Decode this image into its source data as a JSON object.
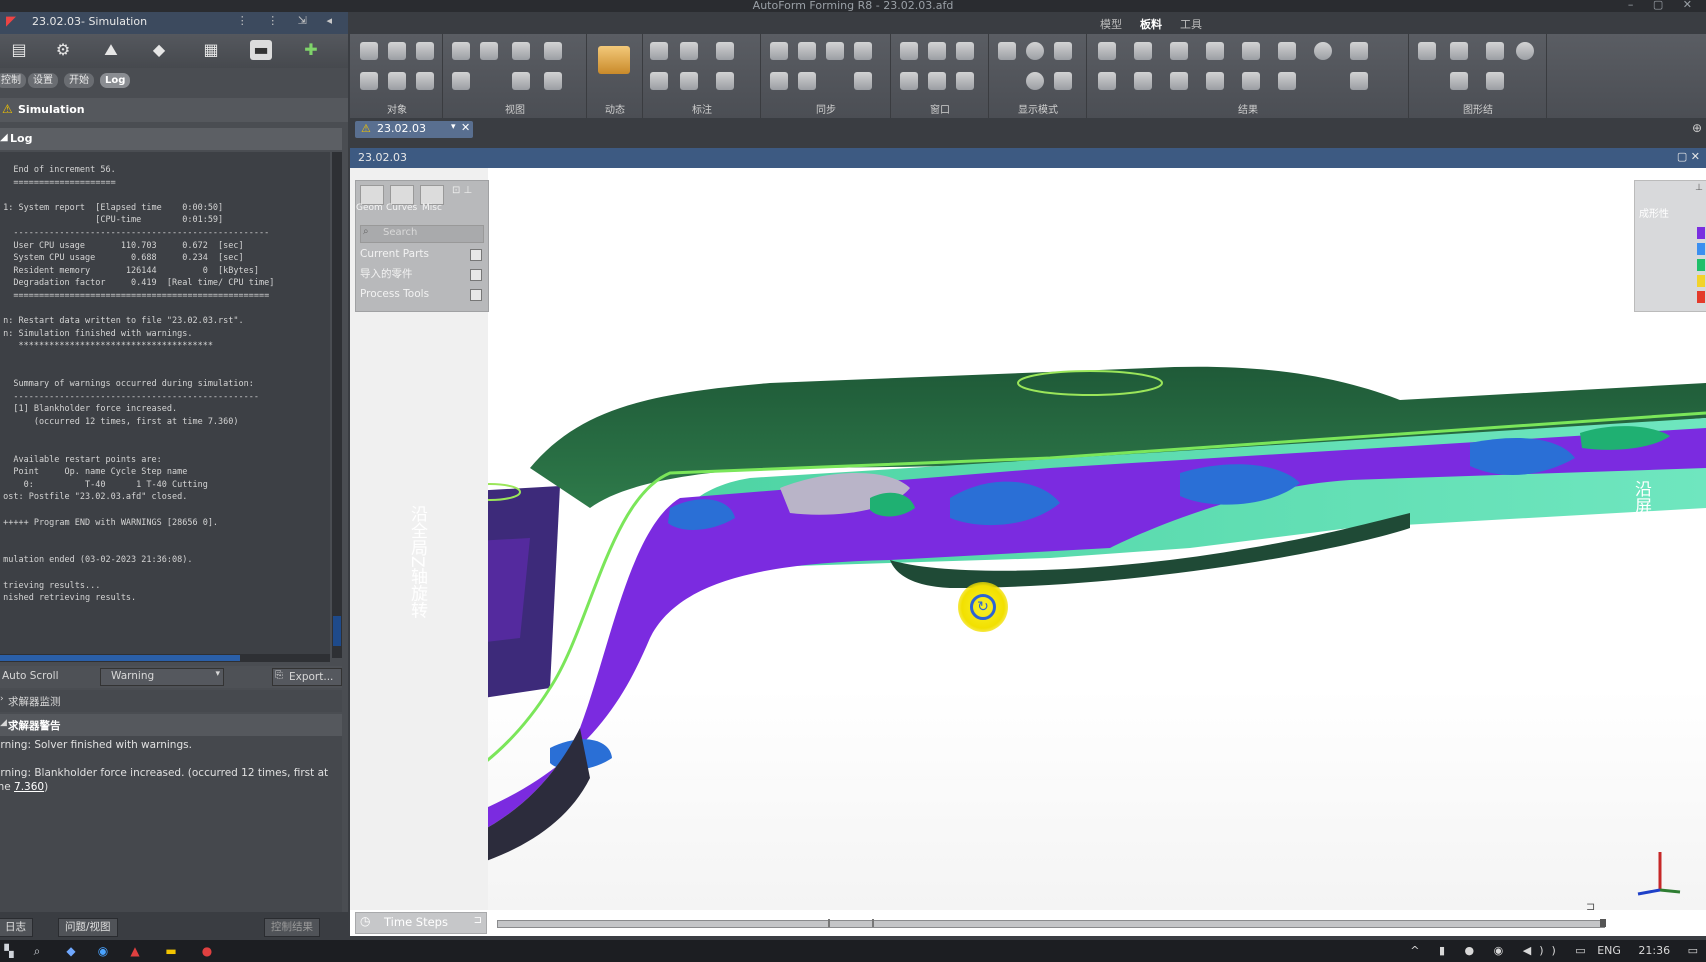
{
  "app": {
    "window_title": "AutoForm Forming R8 - 23.02.03.afd",
    "project_title": "23.02.03- Simulation"
  },
  "left_panel": {
    "tabs": [
      "控制",
      "设置",
      "开始",
      "Log"
    ],
    "simulation_header": "Simulation",
    "log_header": "Log",
    "log_lines": [
      "   End of increment 56.",
      "   ====================",
      "",
      " 1: System report  [Elapsed time    0:00:50]",
      "                   [CPU-time        0:01:59]",
      "   --------------------------------------------------",
      "   User CPU usage       110.703     0.672  [sec]",
      "   System CPU usage       0.688     0.234  [sec]",
      "   Resident memory       126144         0  [kBytes]",
      "   Degradation factor     0.419  [Real time/ CPU time]",
      "   ==================================================",
      "",
      " n: Restart data written to file \"23.02.03.rst\".",
      " n: Simulation finished with warnings.",
      "    **************************************",
      "",
      "",
      "   Summary of warnings occurred during simulation:",
      "   ------------------------------------------------",
      "   [1] Blankholder force increased.",
      "       (occurred 12 times, first at time 7.360)",
      "",
      "",
      "   Available restart points are:",
      "   Point     Op. name Cycle Step name",
      "     0:          T-40      1 T-40 Cutting",
      " ost: Postfile \"23.02.03.afd\" closed.",
      "",
      " +++++ Program END with WARNINGS [28656 0].",
      "",
      "",
      " mulation ended (03-02-2023 21:36:08).",
      "",
      " trieving results...",
      " nished retrieving results."
    ],
    "auto_scroll_label": "Auto Scroll",
    "filter_value": "Warning",
    "export_label": "Export...",
    "section_monitor": "求解器监测",
    "section_warning": "求解器警告",
    "warning1": "arning: Solver finished with warnings.",
    "warning2_prefix": "arning: Blankholder force increased. (occurred 12 times, first at",
    "warning2_cont": "me ",
    "warning2_link": "7.360",
    "warning2_end": ")",
    "bottom_tab_log": "日志",
    "bottom_tab_issues": "问题/视图",
    "bottom_tab_results": "控制结果"
  },
  "ribbon": {
    "tabs": [
      "模型",
      "板料",
      "工具"
    ],
    "groups": [
      "对象",
      "视图",
      "动态",
      "标注",
      "同步",
      "窗口",
      "显示模式",
      "结果",
      "图形结"
    ]
  },
  "document": {
    "tab_label": "23.02.03",
    "header_label": "23.02.03"
  },
  "viewport": {
    "object_tabs": [
      "Geom",
      "Curves",
      "Misc"
    ],
    "search_placeholder": "Search",
    "object_items": [
      "Current Parts",
      "导入的零件",
      "Process Tools"
    ],
    "legend_title": "成形性",
    "legend_colors": [
      "#7a2ee0",
      "#3b8ff0",
      "#1fbf6a",
      "#f2d32a",
      "#e43a2a"
    ],
    "rotate_label_left": "沿全局Z轴旋转",
    "rotate_label_right": "沿屏幕X",
    "time_steps_label": "Time Steps"
  },
  "taskbar": {
    "lang": "ENG",
    "time": "21:36"
  }
}
